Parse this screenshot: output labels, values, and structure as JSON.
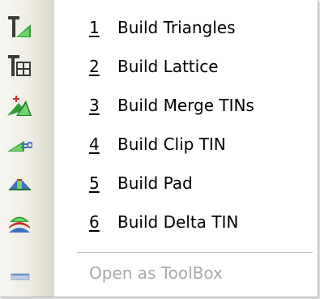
{
  "menu": {
    "items": [
      {
        "accel": "1",
        "label": "Build Triangles",
        "icon": "build-triangles-icon"
      },
      {
        "accel": "2",
        "label": "Build Lattice",
        "icon": "build-lattice-icon"
      },
      {
        "accel": "3",
        "label": "Build Merge TINs",
        "icon": "build-merge-tins-icon"
      },
      {
        "accel": "4",
        "label": "Build Clip TIN",
        "icon": "build-clip-tin-icon"
      },
      {
        "accel": "5",
        "label": "Build Pad",
        "icon": "build-pad-icon"
      },
      {
        "accel": "6",
        "label": "Build Delta TIN",
        "icon": "build-delta-tin-icon"
      }
    ],
    "toolbox": {
      "label": "Open as ToolBox",
      "icon": "toolbox-icon",
      "enabled": false
    }
  },
  "colors": {
    "green": "#2e9e3a",
    "light_green": "#6fd46a",
    "dark": "#3a3a3a",
    "red": "#d22a2a",
    "blue": "#3f6fc2",
    "disabled": "#a8a8a8"
  }
}
